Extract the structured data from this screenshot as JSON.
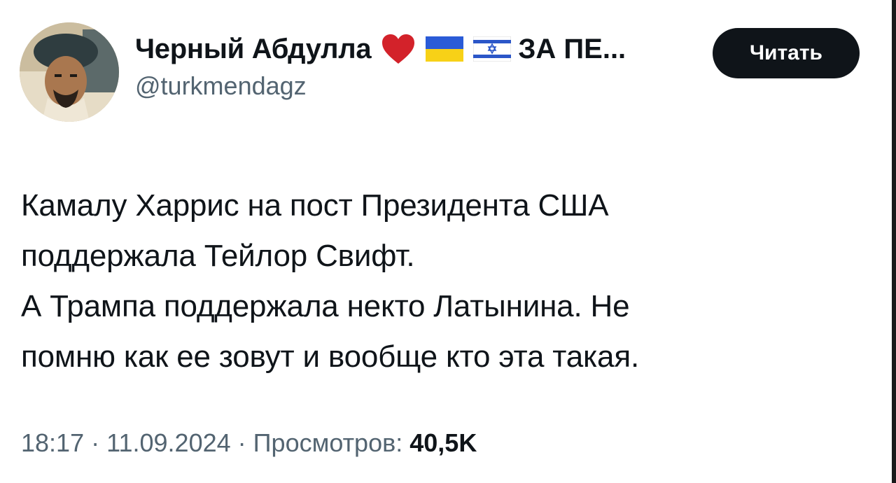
{
  "author": {
    "display_name": "Черный Абдулла",
    "name_suffix": "ЗА ПЕ...",
    "name_emojis": [
      "heart-icon",
      "ukraine-flag-icon",
      "israel-flag-icon"
    ],
    "handle": "@turkmendagz"
  },
  "follow_button": {
    "label": "Читать"
  },
  "tweet": {
    "lines": [
      "Камалу Харрис на пост Президента США",
      "поддержала Тейлор Свифт.",
      "А Трампа поддержала некто Латынина. Не",
      "помню как ее зовут и вообще кто эта такая."
    ]
  },
  "meta": {
    "time": "18:17",
    "separator": "·",
    "date": "11.09.2024",
    "views_label": "Просмотров:",
    "views_count": "40,5K"
  },
  "colors": {
    "text_primary": "#0f1419",
    "text_secondary": "#536471",
    "button_bg": "#0f1419",
    "heart": "#d3222a",
    "ukraine_blue": "#2a5bd7",
    "ukraine_yellow": "#f7d117",
    "israel_blue": "#2b56c8"
  }
}
